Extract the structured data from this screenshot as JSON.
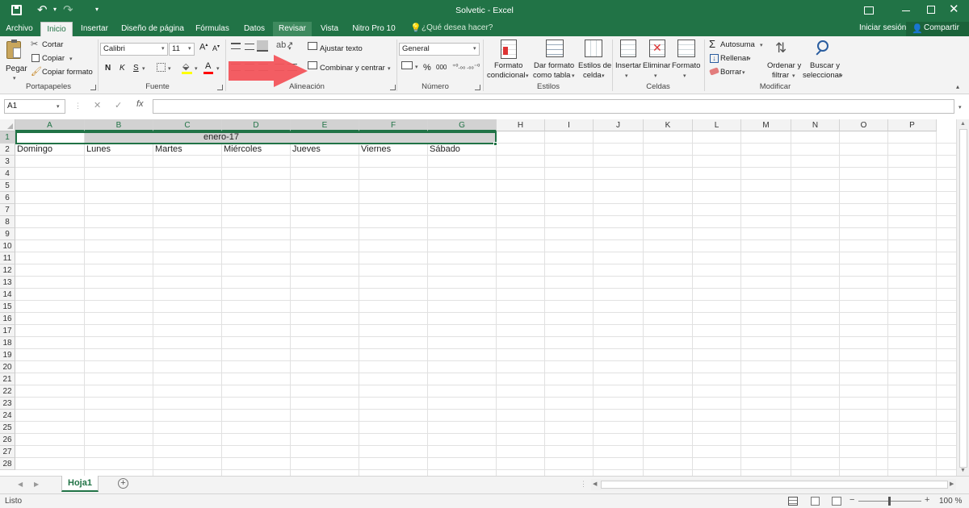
{
  "titlebar": {
    "title": "Solvetic - Excel"
  },
  "tabs": [
    {
      "label": "Archivo"
    },
    {
      "label": "Inicio"
    },
    {
      "label": "Insertar"
    },
    {
      "label": "Diseño de página"
    },
    {
      "label": "Fórmulas"
    },
    {
      "label": "Datos"
    },
    {
      "label": "Revisar"
    },
    {
      "label": "Vista"
    },
    {
      "label": "Nitro Pro 10"
    }
  ],
  "tell_me": "¿Qué desea hacer?",
  "sign_in": "Iniciar sesión",
  "share": "Compartir",
  "ribbon": {
    "clipboard": {
      "paste": "Pegar",
      "cut": "Cortar",
      "copy": "Copiar",
      "format_painter": "Copiar formato",
      "label": "Portapapeles"
    },
    "font": {
      "name": "Calibri",
      "size": "11",
      "bold": "N",
      "italic": "K",
      "underline": "S",
      "label": "Fuente"
    },
    "alignment": {
      "wrap_text": "Ajustar texto",
      "merge_center": "Combinar y centrar",
      "label": "Alineación"
    },
    "number": {
      "format": "General",
      "label": "Número"
    },
    "styles": {
      "conditional": [
        "Formato",
        "condicional"
      ],
      "as_table": [
        "Dar formato",
        "como tabla"
      ],
      "cell_styles": [
        "Estilos de",
        "celda"
      ],
      "label": "Estilos"
    },
    "cells": {
      "insert": "Insertar",
      "delete": "Eliminar",
      "format": "Formato",
      "label": "Celdas"
    },
    "editing": {
      "autosum": "Autosuma",
      "fill": "Rellenar",
      "clear": "Borrar",
      "sort": [
        "Ordenar y",
        "filtrar"
      ],
      "find": [
        "Buscar y",
        "seleccionar"
      ],
      "label": "Modificar"
    }
  },
  "formula_bar": {
    "name_box": "A1",
    "fx": "fx",
    "value": ""
  },
  "grid": {
    "columns": [
      "A",
      "B",
      "C",
      "D",
      "E",
      "F",
      "G",
      "H",
      "I",
      "J",
      "K",
      "L",
      "M",
      "N",
      "O",
      "P"
    ],
    "rows": [
      "1",
      "2",
      "3",
      "4",
      "5",
      "6",
      "7",
      "8",
      "9",
      "10",
      "11",
      "12",
      "13",
      "14",
      "15",
      "16",
      "17",
      "18",
      "19",
      "20",
      "21",
      "22",
      "23",
      "24",
      "25",
      "26",
      "27",
      "28"
    ],
    "merged_title": "enero-17",
    "weekdays": [
      "Domingo",
      "Lunes",
      "Martes",
      "Miércoles",
      "Jueves",
      "Viernes",
      "Sábado"
    ]
  },
  "sheet_tab": "Hoja1",
  "status": {
    "ready": "Listo",
    "zoom": "100 %"
  },
  "colors": {
    "excel_green": "#217346",
    "arrow": "#f2545b"
  }
}
